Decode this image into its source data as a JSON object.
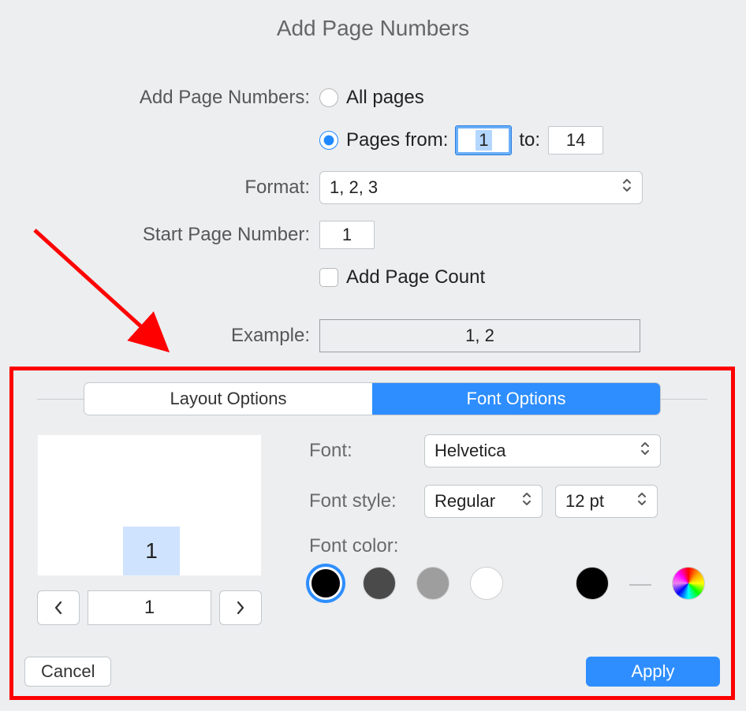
{
  "title": "Add Page Numbers",
  "labels": {
    "add_page_numbers": "Add Page Numbers:",
    "format": "Format:",
    "start_page_number": "Start Page Number:",
    "example": "Example:",
    "font": "Font:",
    "font_style": "Font style:",
    "font_color": "Font color:",
    "to": "to:"
  },
  "radio": {
    "all_pages": "All pages",
    "pages_from": "Pages from:"
  },
  "values": {
    "pages_from_value": "1",
    "pages_to_value": "14",
    "format_value": "1, 2, 3",
    "start_page_value": "1",
    "example_value": "1, 2",
    "font_value": "Helvetica",
    "font_style_value": "Regular",
    "font_size_value": "12 pt",
    "preview_page_number": "1",
    "nav_page": "1"
  },
  "checkbox": {
    "add_page_count": "Add Page Count"
  },
  "tabs": {
    "layout": "Layout Options",
    "font": "Font Options"
  },
  "buttons": {
    "cancel": "Cancel",
    "apply": "Apply"
  },
  "colors": {
    "black": "#000000",
    "dark": "#4a4a4a",
    "gray": "#9e9e9e",
    "white": "#ffffff",
    "custom": "#000000"
  }
}
